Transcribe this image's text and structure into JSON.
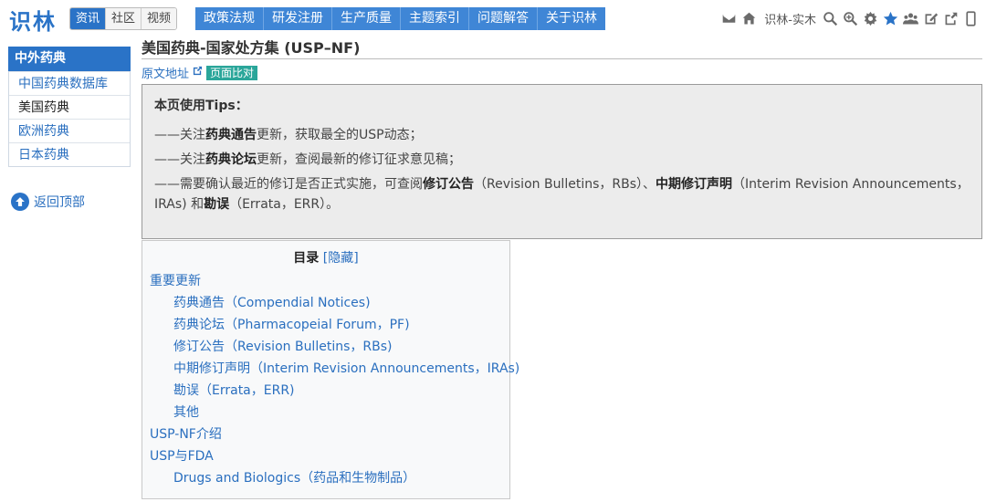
{
  "header": {
    "logo": "识林",
    "seg_tabs": [
      "资讯",
      "社区",
      "视频"
    ],
    "nav": [
      "政策法规",
      "研发注册",
      "生产质量",
      "主题索引",
      "问题解答",
      "关于识林"
    ],
    "user_name": "识林-实木"
  },
  "sidebar": {
    "title": "中外药典",
    "items": [
      "中国药典数据库",
      "美国药典",
      "欧洲药典",
      "日本药典"
    ],
    "back_to_top": "返回顶部"
  },
  "page": {
    "title": "美国药典-国家处方集 (USP–NF)",
    "original_link": "原文地址",
    "compare_label": "页面比对"
  },
  "tips": {
    "title": "本页使用Tips：",
    "line1_a": "——关注",
    "line1_b": "药典通告",
    "line1_c": "更新，获取最全的USP动态；",
    "line2_a": "——关注",
    "line2_b": "药典论坛",
    "line2_c": "更新，查阅最新的修订征求意见稿；",
    "line3_a": "——需要确认最近的修订是否正式实施，可查阅",
    "line3_b": "修订公告",
    "line3_c": "（Revision Bulletins，RBs）、",
    "line3_d": "中期修订声明",
    "line3_e": "（Interim Revision Announcements，IRAs) 和",
    "line3_f": "勘误",
    "line3_g": "（Errata，ERR）。"
  },
  "toc": {
    "title": "目录",
    "hide_label": "[隐藏]",
    "items": [
      {
        "label": "重要更新",
        "level": 1
      },
      {
        "label": "药典通告（Compendial Notices)",
        "level": 2
      },
      {
        "label": "药典论坛（Pharmacopeial Forum，PF)",
        "level": 2
      },
      {
        "label": "修订公告（Revision Bulletins，RBs)",
        "level": 2
      },
      {
        "label": "中期修订声明（Interim Revision Announcements，IRAs)",
        "level": 2
      },
      {
        "label": "勘误（Errata，ERR)",
        "level": 2
      },
      {
        "label": "其他",
        "level": 2
      },
      {
        "label": "USP-NF介绍",
        "level": 1
      },
      {
        "label": "USP与FDA",
        "level": 1
      },
      {
        "label": "Drugs and Biologics（药品和生物制品）",
        "level": 2
      }
    ]
  }
}
